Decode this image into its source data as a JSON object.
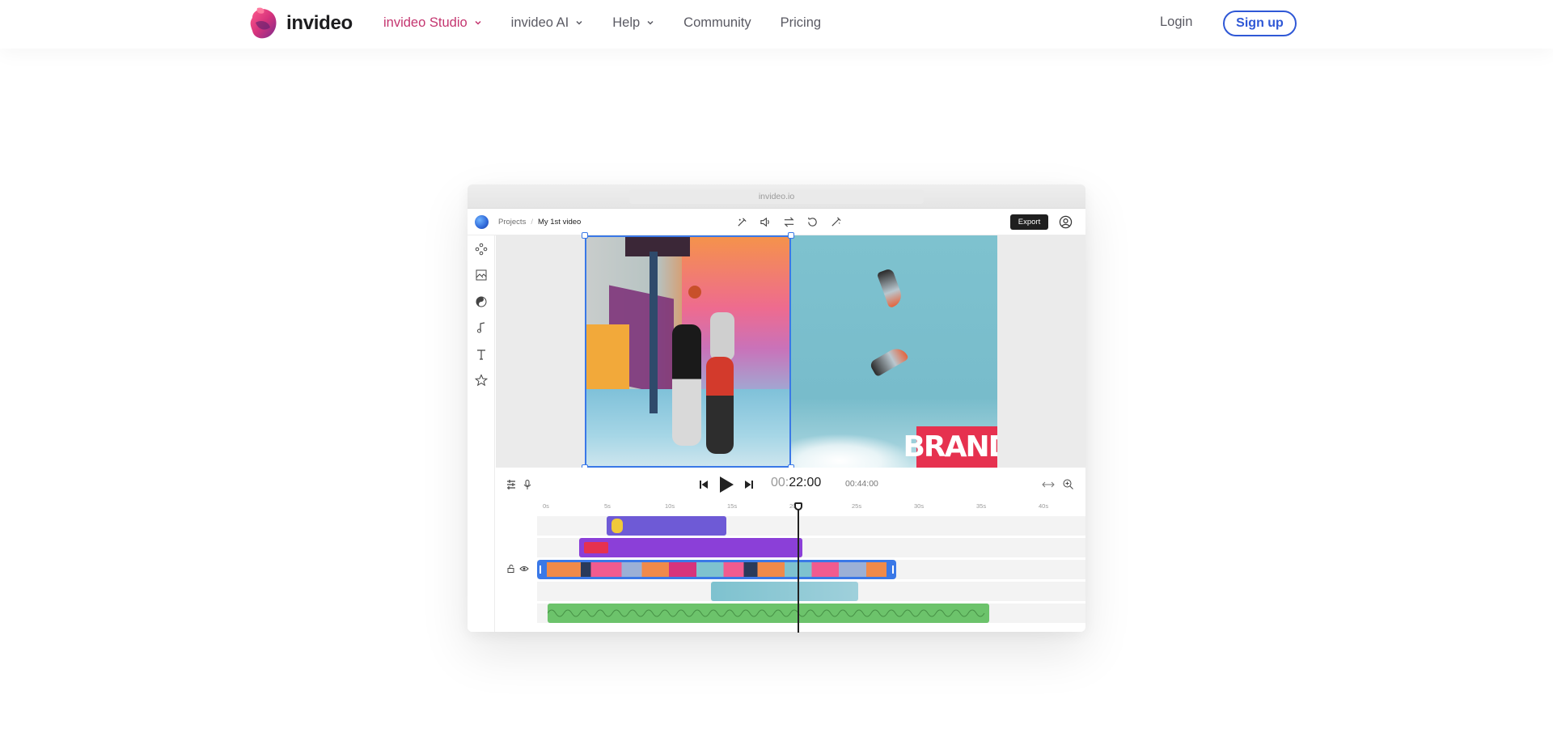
{
  "nav": {
    "brand": "invideo",
    "links": [
      {
        "label": "invideo Studio",
        "dropdown": true,
        "active": true
      },
      {
        "label": "invideo AI",
        "dropdown": true,
        "active": false
      },
      {
        "label": "Help",
        "dropdown": true,
        "active": false
      },
      {
        "label": "Community",
        "dropdown": false,
        "active": false
      },
      {
        "label": "Pricing",
        "dropdown": false,
        "active": false
      }
    ],
    "login": "Login",
    "signup": "Sign up"
  },
  "colors": {
    "accent": "#c4356f",
    "primary_blue": "#2f58d6",
    "selection_blue": "#3a78e7",
    "brand_red": "#e6314f"
  },
  "editor": {
    "url": "invideo.io",
    "breadcrumb": {
      "root": "Projects",
      "separator": "/",
      "current": "My 1st video"
    },
    "toolbar_icons": [
      "magic-cut-icon",
      "volume-icon",
      "swap-icon",
      "rotate-icon",
      "wand-icon"
    ],
    "export_label": "Export",
    "sidebar_icons": [
      "layers-icon",
      "media-icon",
      "color-icon",
      "music-icon",
      "text-icon",
      "star-icon"
    ],
    "brand_overlay": "BRAND",
    "playback": {
      "current_prefix": "00:",
      "current": "22:00",
      "duration": "00:44:00"
    },
    "ruler_ticks": [
      "0s",
      "5s",
      "10s",
      "15s",
      "20s",
      "25s",
      "30s",
      "35s",
      "40s"
    ]
  }
}
